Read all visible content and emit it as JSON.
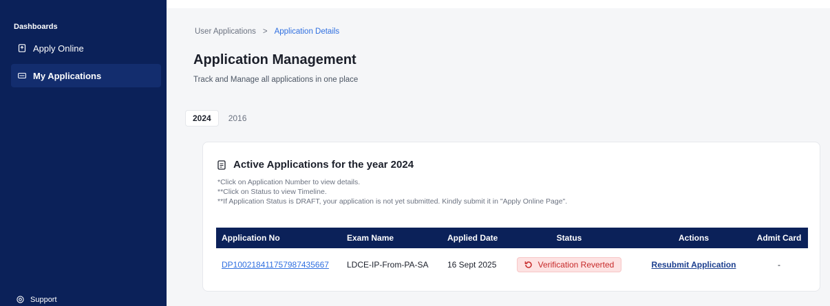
{
  "sidebar": {
    "section": "Dashboards",
    "items": [
      {
        "label": "Apply Online",
        "icon": "document-upload-icon"
      },
      {
        "label": "My Applications",
        "icon": "card-list-icon",
        "active": true
      }
    ],
    "support": {
      "label": "Support",
      "icon": "lifebuoy-icon"
    }
  },
  "breadcrumb": {
    "parent": "User Applications",
    "separator": ">",
    "current": "Application Details"
  },
  "page": {
    "title": "Application Management",
    "subtitle": "Track and Manage all applications in one place"
  },
  "year_tabs": [
    {
      "label": "2024",
      "active": true
    },
    {
      "label": "2016",
      "active": false
    }
  ],
  "card": {
    "title": "Active Applications for the year 2024",
    "notes": [
      "*Click on Application Number to view details.",
      "**Click on Status to view Timeline.",
      "**If Application Status is DRAFT, your application is not yet submitted. Kindly submit it in \"Apply Online Page\"."
    ]
  },
  "table": {
    "headers": [
      "Application No",
      "Exam Name",
      "Applied Date",
      "Status",
      "Actions",
      "Admit Card"
    ],
    "rows": [
      {
        "application_no": "DP100218411757987435667",
        "exam_name": "LDCE-IP-From-PA-SA",
        "applied_date": "16 Sept 2025",
        "status": "Verification Reverted",
        "action": "Resubmit Application",
        "admit_card": "-"
      }
    ]
  },
  "colors": {
    "sidebar_bg": "#0b2159",
    "link_blue": "#2f6fe0",
    "status_red_bg": "#fde2e2",
    "status_red_text": "#c62828"
  }
}
